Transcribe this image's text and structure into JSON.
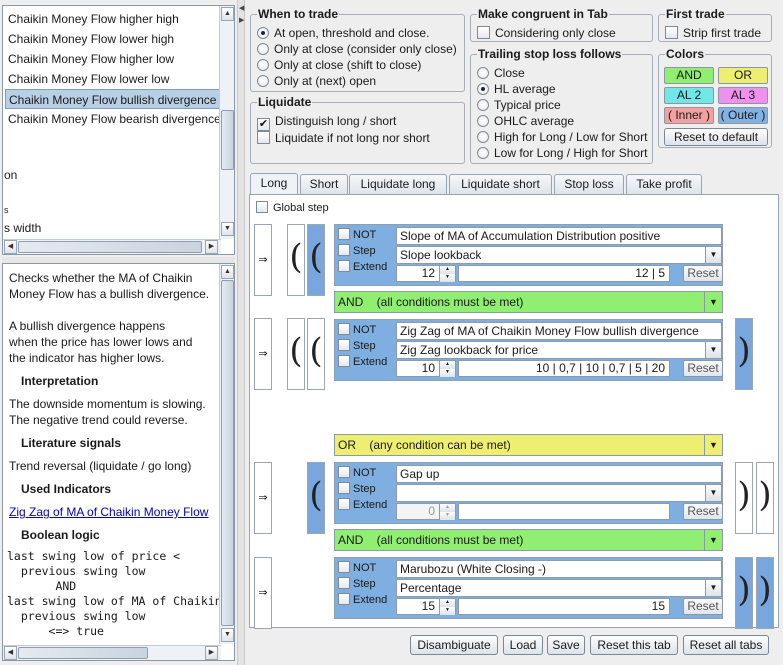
{
  "indicator_list": {
    "items": [
      "Chaikin Money Flow higher high",
      "Chaikin Money Flow lower high",
      "Chaikin Money Flow higher low",
      "Chaikin Money Flow lower low",
      "Chaikin Money Flow bullish divergence",
      "Chaikin Money Flow bearish divergence"
    ],
    "selected_index": 4,
    "partial_1": "on",
    "partial_2": "s",
    "partial_3": "s width"
  },
  "description": {
    "p1": [
      "Checks whether the MA of Chaikin",
      "Money Flow has a bullish divergence."
    ],
    "p2": [
      "A bullish divergence happens",
      "when the price has lower lows and",
      "the indicator has higher lows."
    ],
    "interpretation_heading": "Interpretation",
    "interpretation": [
      "The downside momentum is slowing.",
      "The negative trend could reverse."
    ],
    "literature_heading": "Literature signals",
    "literature": "Trend reversal (liquidate / go long)",
    "used_heading": "Used Indicators",
    "used_link": "Zig Zag of MA of Chaikin Money Flow",
    "boolean_heading": "Boolean logic",
    "boolean_lines": [
      "last swing low of price <",
      "  previous swing low",
      "       AND",
      "last swing low of MA of Chaikin",
      "  previous swing low",
      "      <=> true"
    ]
  },
  "when_to_trade": {
    "title": "When to trade",
    "options": [
      "At open, threshold and close.",
      "Only at close (consider only close)",
      "Only at close (shift to close)",
      "Only at (next) open"
    ],
    "selected": 0
  },
  "congruent": {
    "title": "Make congruent in Tab",
    "option": "Considering only close",
    "checked": false
  },
  "first_trade": {
    "title": "First trade",
    "option": "Strip first trade",
    "checked": false
  },
  "liquidate": {
    "title": "Liquidate",
    "options": [
      "Distinguish long / short",
      "Liquidate if not long nor short"
    ],
    "checked": [
      true,
      false
    ]
  },
  "trailing": {
    "title": "Trailing stop loss follows",
    "options": [
      "Close",
      "HL average",
      "Typical price",
      "OHLC average",
      "High for Long / Low for Short",
      "Low for Long / High for Short"
    ],
    "selected": 1
  },
  "colors": {
    "title": "Colors",
    "buttons": [
      {
        "label": "AND",
        "bg": "#90ee70",
        "fg": "#1a1a1a"
      },
      {
        "label": "OR",
        "bg": "#eeee70",
        "fg": "#1a1a1a"
      },
      {
        "label": "AL 2",
        "bg": "#70e6e6",
        "fg": "#1a1a1a"
      },
      {
        "label": "AL 3",
        "bg": "#ee90ee",
        "fg": "#1a1a1a"
      },
      {
        "label": "( Inner )",
        "bg": "#f2a0a0",
        "fg": "#1a1a1a"
      },
      {
        "label": "( Outer )",
        "bg": "#82b2e4",
        "fg": "#1a1a1a"
      }
    ],
    "reset_label": "Reset to default"
  },
  "tabs": [
    "Long",
    "Short",
    "Liquidate long",
    "Liquidate short",
    "Stop loss",
    "Take profit"
  ],
  "active_tab": 0,
  "global_step": {
    "label": "Global step",
    "checked": false
  },
  "flags": {
    "not": "NOT",
    "step": "Step",
    "extend": "Extend"
  },
  "combiner_colors": {
    "and": "#90ee70",
    "or": "#eeee70"
  },
  "blocks": [
    {
      "title": "Slope of MA of Accumulation Distribution positive",
      "param": "Slope lookback",
      "spin": "12",
      "values": "12  |  5",
      "reset": "Reset"
    },
    {
      "combiner": "AND    (all conditions must be met)",
      "title": "Zig Zag of MA of Chaikin Money Flow bullish divergence",
      "param": "Zig Zag lookback for price",
      "spin": "10",
      "values": "10  |  0,7  |  10  |  0,7  |  5  |  20",
      "reset": "Reset"
    },
    {
      "combiner": "OR    (any condition can be met)",
      "title": "Gap up",
      "param": "",
      "spin": "0",
      "values": "",
      "reset": "Reset"
    },
    {
      "combiner": "AND    (all conditions must be met)",
      "title": "Marubozu (White Closing -)",
      "param": "Percentage",
      "spin": "15",
      "values": "15",
      "reset": "Reset"
    }
  ],
  "impl_symbol": "⇒",
  "bottom_buttons": [
    "Disambiguate",
    "Load",
    "Save",
    "Reset this tab",
    "Reset all tabs"
  ]
}
